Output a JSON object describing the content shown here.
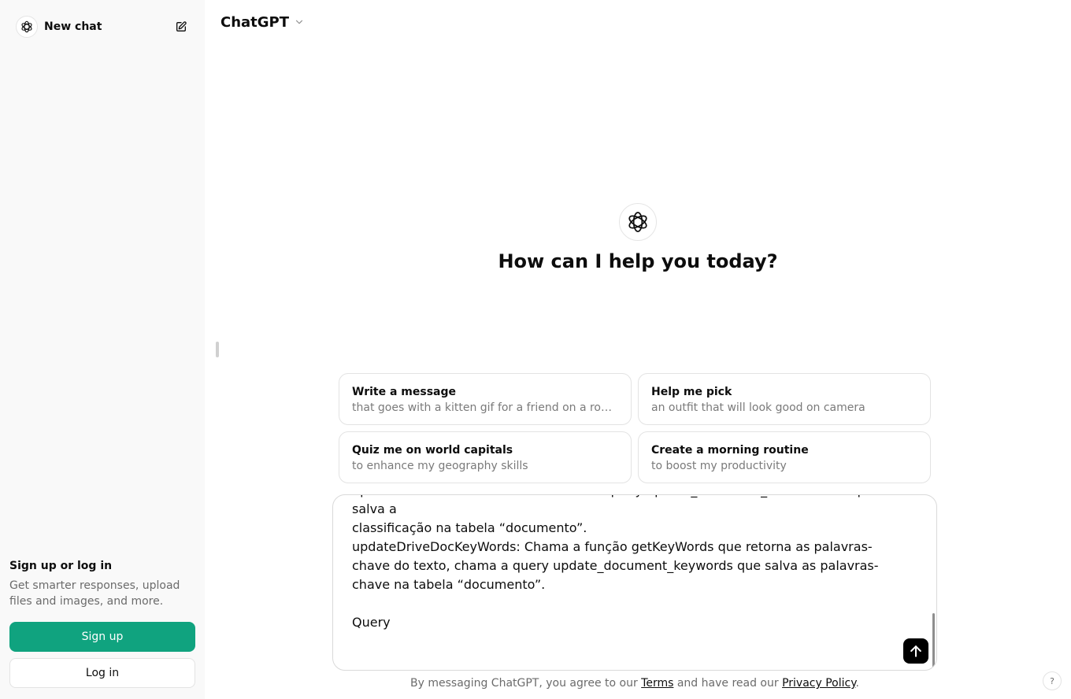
{
  "sidebar": {
    "new_chat_label": "New chat",
    "logo_icon": "openai-logo-icon",
    "edit_icon": "compose-icon",
    "signup_title": "Sign up or log in",
    "signup_desc": "Get smarter responses, upload files and images, and more.",
    "signup_button": "Sign up",
    "login_button": "Log in"
  },
  "header": {
    "model_name": "ChatGPT",
    "chevron_icon": "chevron-down-icon"
  },
  "main": {
    "hero_title": "How can I help you today?",
    "suggestions": [
      {
        "title": "Write a message",
        "subtitle": "that goes with a kitten gif for a friend on a rough day"
      },
      {
        "title": "Help me pick",
        "subtitle": "an outfit that will look good on camera"
      },
      {
        "title": "Quiz me on world capitals",
        "subtitle": "to enhance my geography skills"
      },
      {
        "title": "Create a morning routine",
        "subtitle": "to boost my productivity"
      }
    ]
  },
  "composer": {
    "lines": [
      "updateDriveDocClassification: Chama a query update_document_classification que salva a",
      "classificação na tabela “documento”.",
      "updateDriveDocKeyWords: Chama a função getKeyWords que retorna as palavras-",
      "chave do texto, chama a query update_document_keywords que salva as palavras-",
      "chave na tabela “documento”.",
      "",
      "Query"
    ],
    "send_icon": "arrow-up-icon"
  },
  "footer": {
    "prefix": "By messaging ChatGPT, you agree to our ",
    "terms": "Terms",
    "middle": " and have read our ",
    "privacy": "Privacy Policy",
    "suffix": "."
  },
  "help": {
    "label": "?"
  },
  "colors": {
    "sidebar_bg": "#f9f9f9",
    "accent": "#10a37f",
    "send_bg": "#000000"
  }
}
